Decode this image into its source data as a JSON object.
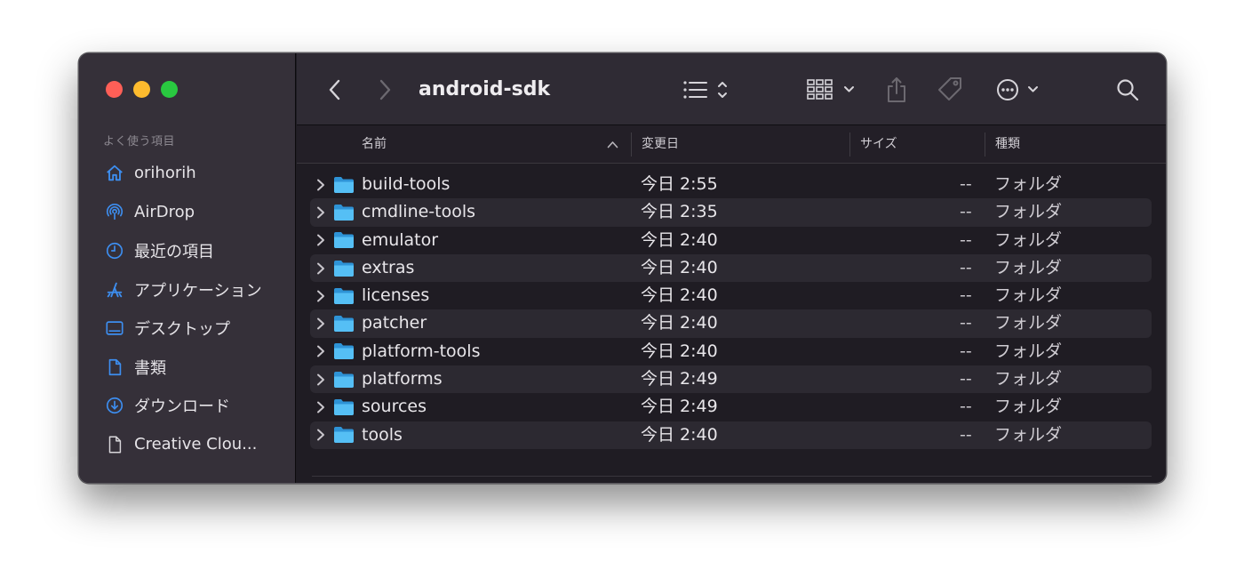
{
  "window": {
    "title": "android-sdk"
  },
  "sidebar": {
    "section_label": "よく使う項目",
    "items": [
      {
        "label": "orihorih",
        "icon": "home-icon"
      },
      {
        "label": "AirDrop",
        "icon": "airdrop-icon"
      },
      {
        "label": "最近の項目",
        "icon": "clock-icon"
      },
      {
        "label": "アプリケーション",
        "icon": "applications-icon"
      },
      {
        "label": "デスクトップ",
        "icon": "desktop-icon"
      },
      {
        "label": "書類",
        "icon": "document-icon"
      },
      {
        "label": "ダウンロード",
        "icon": "download-icon"
      },
      {
        "label": "Creative Clou...",
        "icon": "file-icon"
      }
    ]
  },
  "columns": {
    "name": "名前",
    "date": "変更日",
    "size": "サイズ",
    "kind": "種類"
  },
  "rows": [
    {
      "name": "build-tools",
      "date": "今日 2:55",
      "size": "--",
      "kind": "フォルダ"
    },
    {
      "name": "cmdline-tools",
      "date": "今日 2:35",
      "size": "--",
      "kind": "フォルダ"
    },
    {
      "name": "emulator",
      "date": "今日 2:40",
      "size": "--",
      "kind": "フォルダ"
    },
    {
      "name": "extras",
      "date": "今日 2:40",
      "size": "--",
      "kind": "フォルダ"
    },
    {
      "name": "licenses",
      "date": "今日 2:40",
      "size": "--",
      "kind": "フォルダ"
    },
    {
      "name": "patcher",
      "date": "今日 2:40",
      "size": "--",
      "kind": "フォルダ"
    },
    {
      "name": "platform-tools",
      "date": "今日 2:40",
      "size": "--",
      "kind": "フォルダ"
    },
    {
      "name": "platforms",
      "date": "今日 2:49",
      "size": "--",
      "kind": "フォルダ"
    },
    {
      "name": "sources",
      "date": "今日 2:49",
      "size": "--",
      "kind": "フォルダ"
    },
    {
      "name": "tools",
      "date": "今日 2:40",
      "size": "--",
      "kind": "フォルダ"
    }
  ],
  "colors": {
    "accent": "#3d8ef0",
    "folder": "#4fb3f0",
    "close": "#fe5f57",
    "minimize": "#febb2e",
    "zoom": "#29c840"
  }
}
